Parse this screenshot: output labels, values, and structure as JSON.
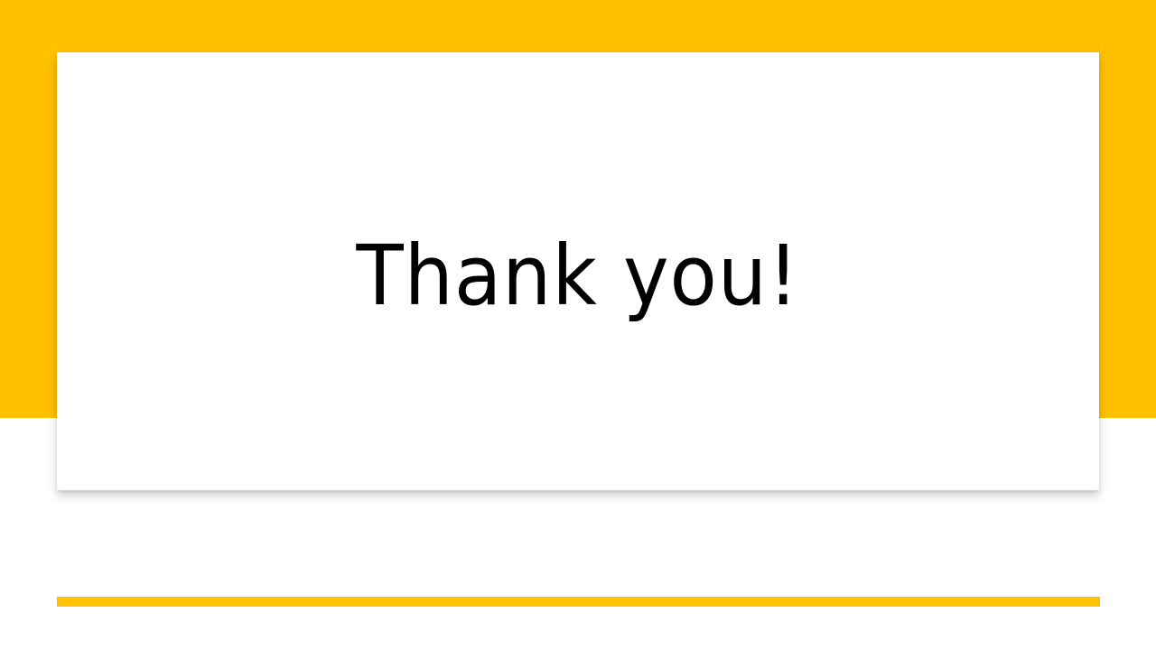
{
  "slide": {
    "title": "Thank you!"
  },
  "colors": {
    "accent": "#FFC000",
    "card": "#FFFFFF",
    "text": "#000000"
  }
}
